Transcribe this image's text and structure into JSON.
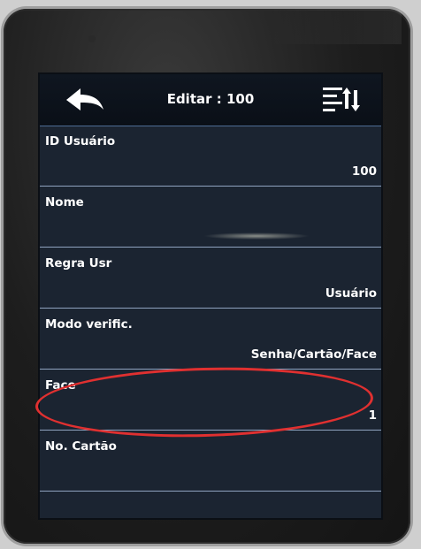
{
  "header": {
    "title": "Editar : 100",
    "back_icon": "back-arrow-icon",
    "menu_icon": "sort-list-icon"
  },
  "fields": [
    {
      "label": "ID Usuário",
      "value": "100"
    },
    {
      "label": "Nome",
      "value": ""
    },
    {
      "label": "Regra Usr",
      "value": "Usuário"
    },
    {
      "label": "Modo verific.",
      "value": "Senha/Cartão/Face"
    },
    {
      "label": "Face",
      "value": "1"
    },
    {
      "label": "No. Cartão",
      "value": ""
    }
  ],
  "colors": {
    "screen_bg": "#1b2431",
    "divider": "#8fa3c0",
    "annotation_circle": "#e03030"
  }
}
